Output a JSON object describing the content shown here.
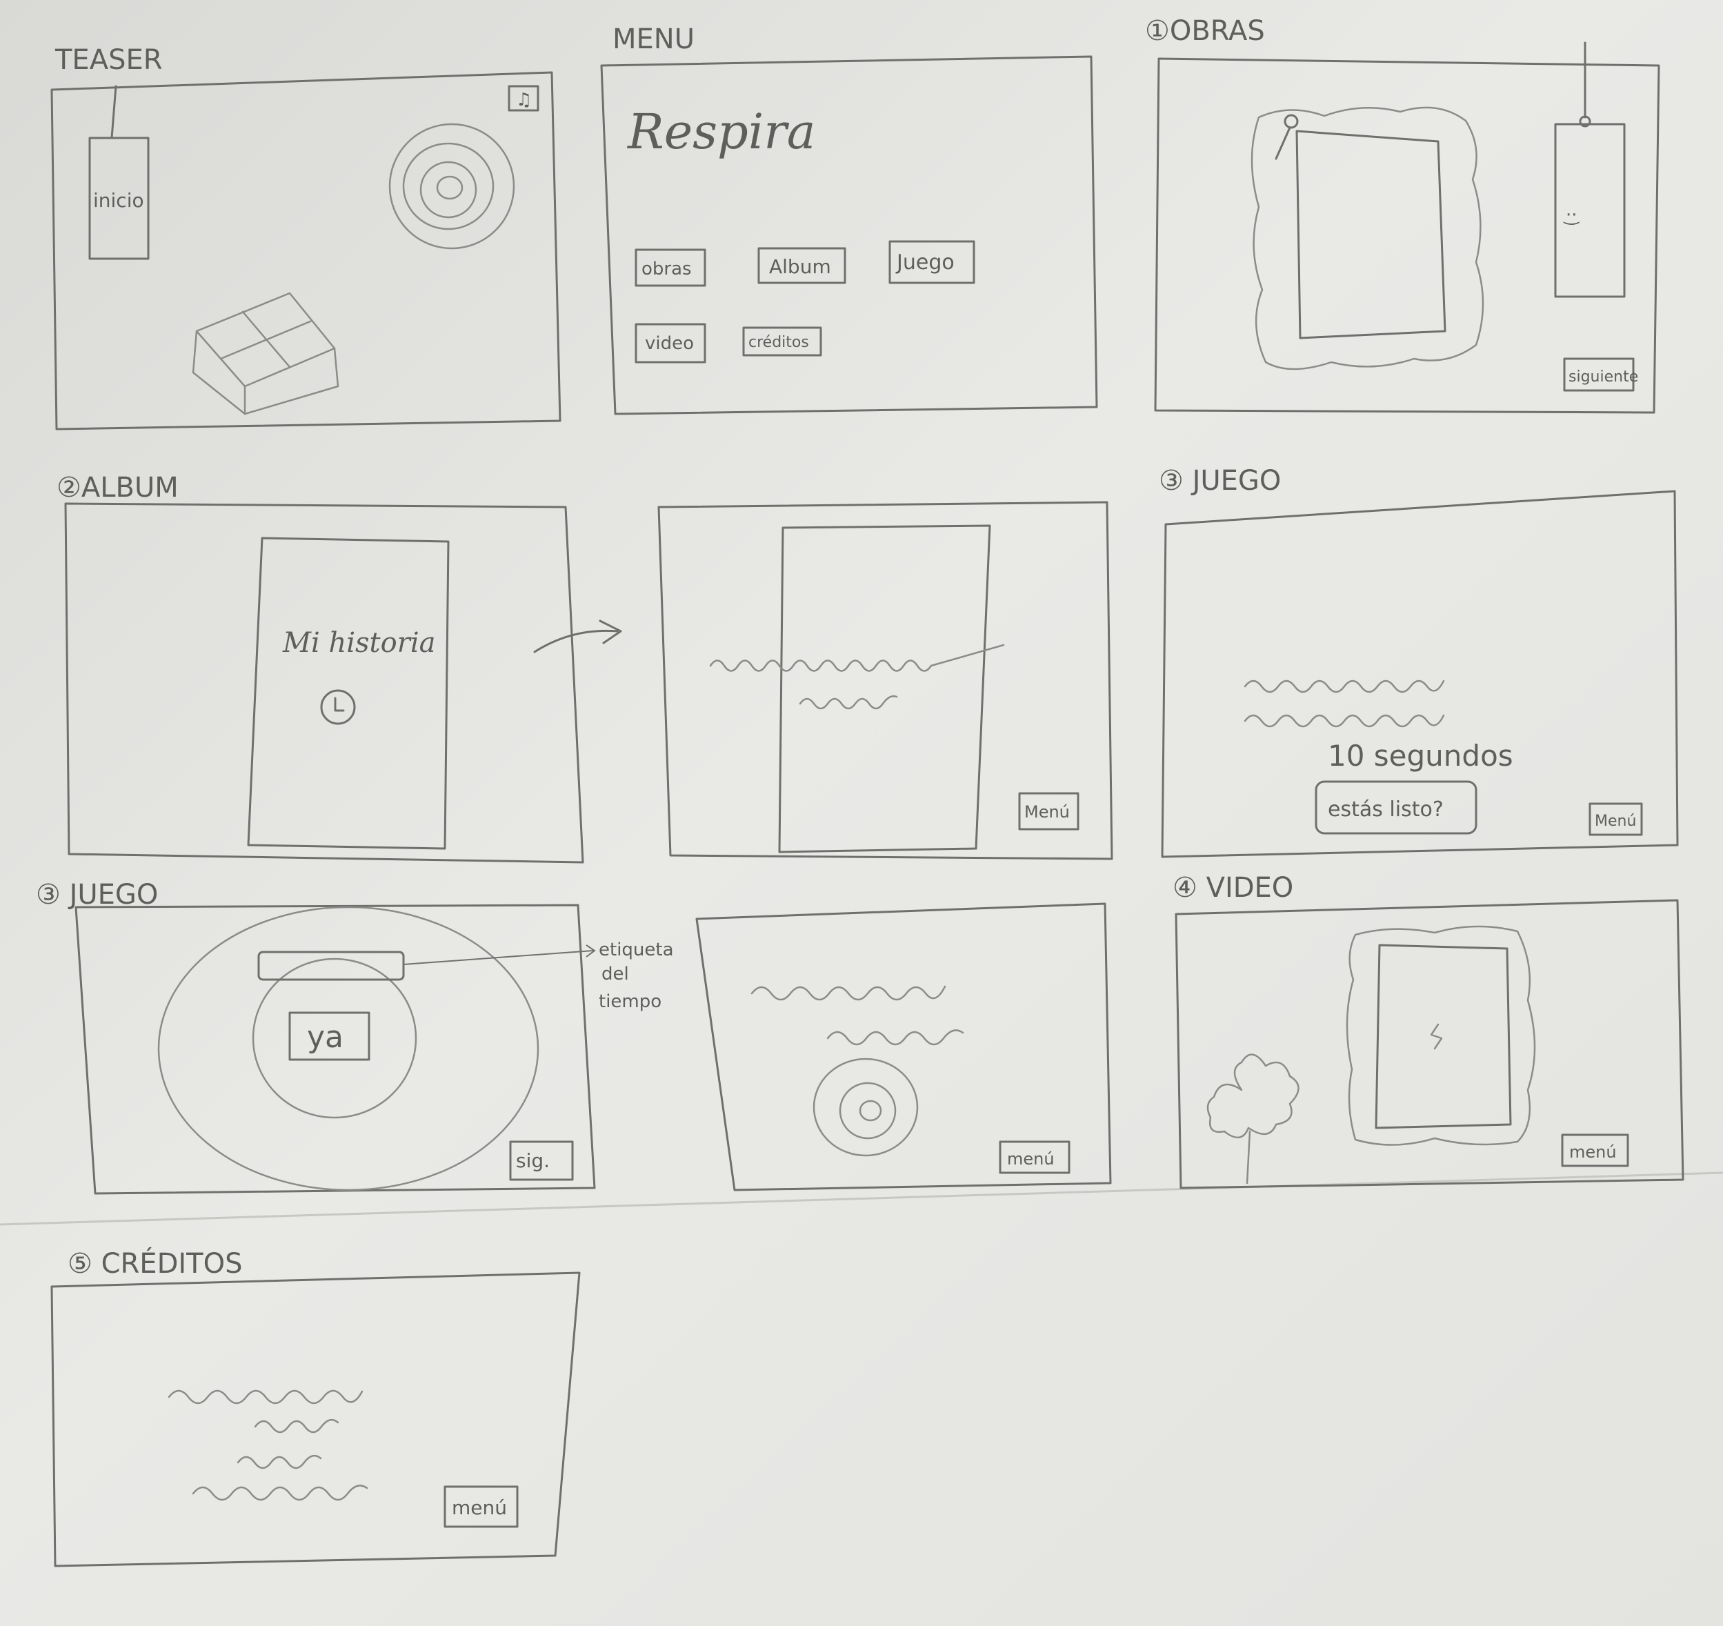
{
  "headings": {
    "teaser": "TEASER",
    "menu": "MENU",
    "obras": "①OBRAS",
    "album": "②ALBUM",
    "juego_a": "③ JUEGO",
    "juego_b": "③ JUEGO",
    "video": "④ VIDEO",
    "creditos": "⑤ CRÉDITOS"
  },
  "teaser": {
    "tag_label": "inicio",
    "sound_icon": "music-icon"
  },
  "menu": {
    "title": "Respira",
    "buttons": [
      "obras",
      "Album",
      "Juego",
      "video",
      "créditos"
    ]
  },
  "obras": {
    "next_label": "siguiente"
  },
  "album": {
    "book_title": "Mi historia",
    "menu_label": "Menú"
  },
  "juego": {
    "timer_text": "10 segundos",
    "ready_label": "estás listo?",
    "menu_label": "Menú",
    "ya_label": "ya",
    "next_label": "sig.",
    "annotation": [
      "etiqueta",
      "del",
      "tiempo"
    ],
    "menu_label_2": "menú"
  },
  "video": {
    "menu_label": "menú"
  },
  "creditos": {
    "menu_label": "menú"
  },
  "colors": {
    "paper": "#e6e6e3",
    "pencil": "#6f6f6d"
  }
}
